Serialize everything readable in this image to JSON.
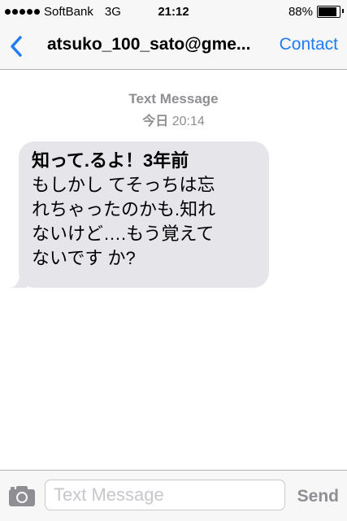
{
  "status_bar": {
    "carrier": "SoftBank",
    "network": "3G",
    "time": "21:12",
    "battery_percent_label": "88%",
    "battery_level": 0.88
  },
  "nav": {
    "back_icon": "chevron-left-icon",
    "title": "atsuko_100_sato@gme...",
    "contact_label": "Contact",
    "accent_color": "#1f7cf6"
  },
  "conversation": {
    "service_label": "Text Message",
    "day_label": "今日",
    "time_label": "20:14",
    "message_lines": [
      "知って.るよ！3年前",
      "もしかし てそっちは忘",
      "れちゃったのかも.知れ",
      "ないけど….もう覚えて",
      "ないです か?"
    ]
  },
  "input_bar": {
    "camera_icon": "camera-icon",
    "placeholder": "Text Message",
    "send_label": "Send"
  }
}
